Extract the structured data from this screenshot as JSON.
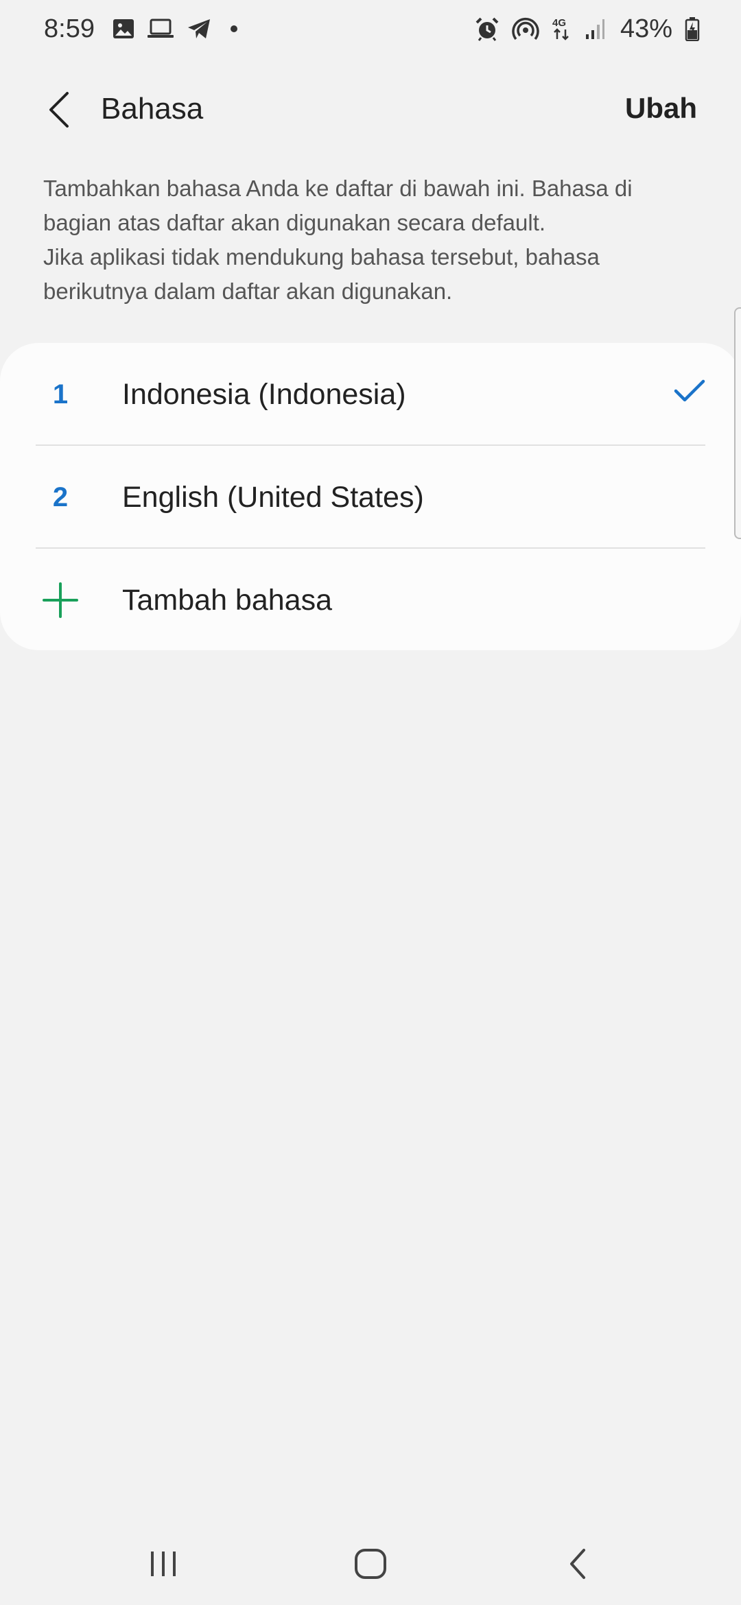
{
  "status_bar": {
    "time": "8:59",
    "left_icons": [
      "gallery-icon",
      "laptop-icon",
      "telegram-icon",
      "dot"
    ],
    "right_icons": [
      "alarm-icon",
      "hotspot-icon",
      "4g-icon",
      "signal-icon"
    ],
    "battery_percent": "43%"
  },
  "header": {
    "title": "Bahasa",
    "edit_label": "Ubah"
  },
  "description": {
    "line1": "Tambahkan bahasa Anda ke daftar di bawah ini. Bahasa di bagian atas daftar akan digunakan secara default.",
    "line2": "Jika aplikasi tidak mendukung bahasa tersebut, bahasa berikutnya dalam daftar akan digunakan."
  },
  "languages": [
    {
      "number": "1",
      "label": "Indonesia (Indonesia)",
      "selected": true
    },
    {
      "number": "2",
      "label": "English (United States)",
      "selected": false
    }
  ],
  "add_language": {
    "label": "Tambah bahasa"
  },
  "colors": {
    "accent_blue": "#1a73c9",
    "add_green": "#19a05a",
    "background": "#f2f2f2",
    "card": "#fcfcfc"
  }
}
